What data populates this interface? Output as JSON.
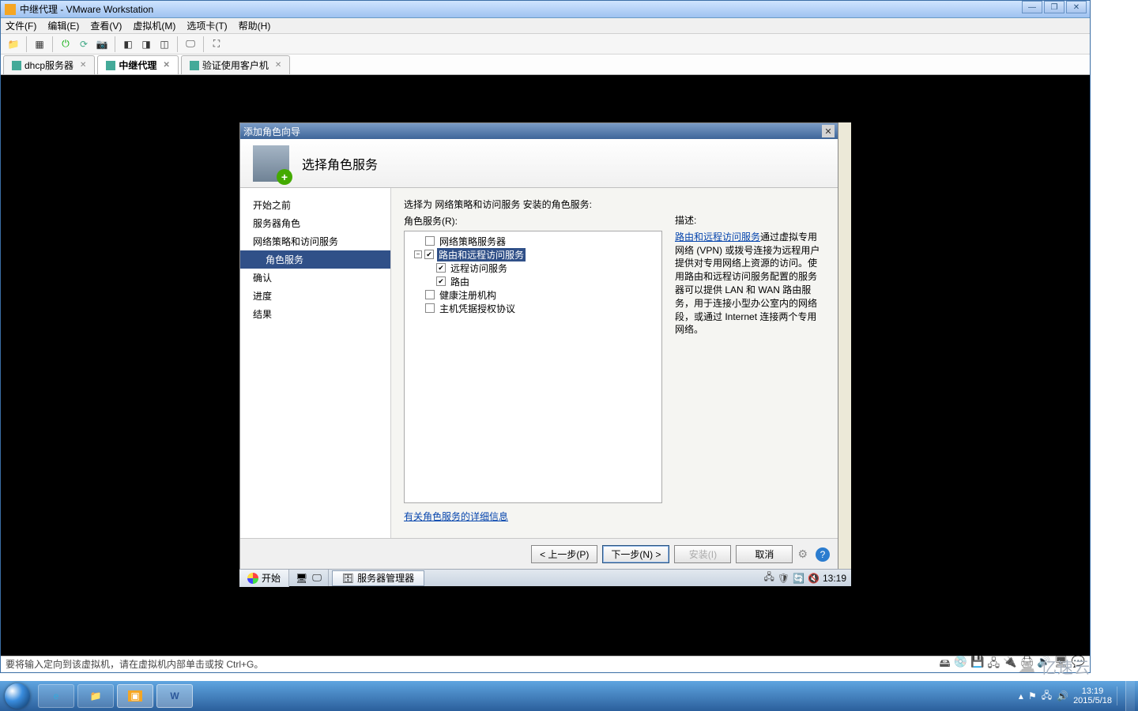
{
  "vm_window": {
    "title": "中继代理 - VMware Workstation",
    "controls": {
      "min": "—",
      "max": "❐",
      "close": "✕"
    }
  },
  "menubar": [
    "文件(F)",
    "编辑(E)",
    "查看(V)",
    "虚拟机(M)",
    "选项卡(T)",
    "帮助(H)"
  ],
  "tabs": [
    {
      "label": "dhcp服务器",
      "active": false
    },
    {
      "label": "中继代理",
      "active": true
    },
    {
      "label": "验证使用客户机",
      "active": false
    }
  ],
  "wizard": {
    "window_title": "添加角色向导",
    "header_title": "选择角色服务",
    "nav": [
      {
        "label": "开始之前"
      },
      {
        "label": "服务器角色"
      },
      {
        "label": "网络策略和访问服务"
      },
      {
        "label": "角色服务",
        "selected": true,
        "indent": true
      },
      {
        "label": "确认"
      },
      {
        "label": "进度"
      },
      {
        "label": "结果"
      }
    ],
    "prompt": "选择为 网络策略和访问服务 安装的角色服务:",
    "tree_label": "角色服务(R):",
    "tree": [
      {
        "label": "网络策略服务器",
        "checked": false,
        "level": 0
      },
      {
        "label": "路由和远程访问服务",
        "checked": true,
        "level": 1,
        "selected": true,
        "expander": "−"
      },
      {
        "label": "远程访问服务",
        "checked": true,
        "level": 2
      },
      {
        "label": "路由",
        "checked": true,
        "level": 2
      },
      {
        "label": "健康注册机构",
        "checked": false,
        "level": 0
      },
      {
        "label": "主机凭据授权协议",
        "checked": false,
        "level": 0
      }
    ],
    "desc_head": "描述:",
    "desc_link": "路由和远程访问服务",
    "desc_text": "通过虚拟专用网络 (VPN) 或拨号连接为远程用户提供对专用网络上资源的访问。使用路由和远程访问服务配置的服务器可以提供 LAN 和 WAN 路由服务，用于连接小型办公室内的网络段，或通过 Internet 连接两个专用网络。",
    "more_link": "有关角色服务的详细信息",
    "buttons": {
      "prev": "< 上一步(P)",
      "next": "下一步(N) >",
      "install": "安装(I)",
      "cancel": "取消"
    }
  },
  "guest_taskbar": {
    "start": "开始",
    "task1": "服务器管理器",
    "clock": "13:19"
  },
  "vm_status": "要将输入定向到该虚拟机，请在虚拟机内部单击或按 Ctrl+G。",
  "host": {
    "clock_time": "13:19",
    "clock_date": "2015/5/18"
  },
  "watermark": "亿速云"
}
